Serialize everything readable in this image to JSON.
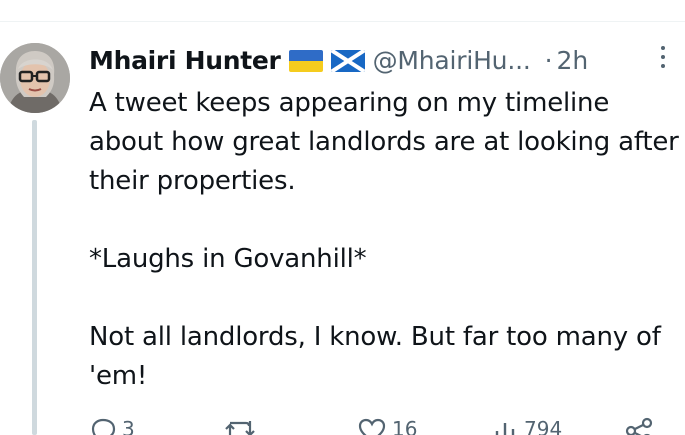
{
  "tweet": {
    "author_name": "Mhairi Hunter",
    "handle": "@MhairiHu...",
    "separator": "·",
    "time": "2h",
    "paragraphs": [
      "A tweet keeps appearing on my timeline about how great landlords are at looking after their properties.",
      "*Laughs in Govanhill*",
      "Not all landlords, I know. But far too many of 'em!"
    ],
    "flags": [
      "ukraine-flag-icon",
      "scotland-flag-icon"
    ]
  },
  "actions": {
    "reply_count": "3",
    "retweet_count": "",
    "like_count": "16",
    "views_count": "794"
  },
  "colors": {
    "text": "#0f1419",
    "muted": "#536471",
    "thread_line": "#cfd9de",
    "divider": "#eff3f4"
  }
}
